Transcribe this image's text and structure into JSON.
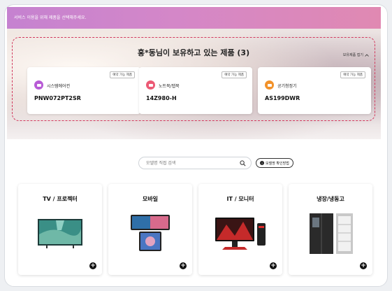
{
  "banner": {
    "text": "서비스 이용을 위해 제품을 선택해주세요."
  },
  "owned": {
    "title": "홍*동님이 보유하고 있는 제품 (3)",
    "collapse_label": "보유제품 접기",
    "items": [
      {
        "reserve_label": "예약 가능 제품",
        "category": "시스템에어컨",
        "model": "PNW072PT2SR",
        "icon": "aircon-icon",
        "icon_color": "#b85bd6"
      },
      {
        "reserve_label": "예약 가능 제품",
        "category": "노트북/탭북",
        "model": "14Z980-H",
        "icon": "laptop-icon",
        "icon_color": "#ec5a75"
      },
      {
        "reserve_label": "예약 가능 제품",
        "category": "공기청정기",
        "model": "AS199DWR",
        "icon": "air-purifier-icon",
        "icon_color": "#f2922a"
      }
    ]
  },
  "search": {
    "placeholder": "모델명 직접 검색",
    "help_label": "모델명 확인방법"
  },
  "categories": [
    {
      "name": "TV / 프로젝터",
      "image": "tv-image"
    },
    {
      "name": "모바일",
      "image": "phone-image"
    },
    {
      "name": "IT / 모니터",
      "image": "monitor-image"
    },
    {
      "name": "냉장/냉동고",
      "image": "fridge-image"
    }
  ],
  "colors": {
    "accent": "#d2395e",
    "banner_start": "#c582d0",
    "banner_end": "#e089b2"
  }
}
